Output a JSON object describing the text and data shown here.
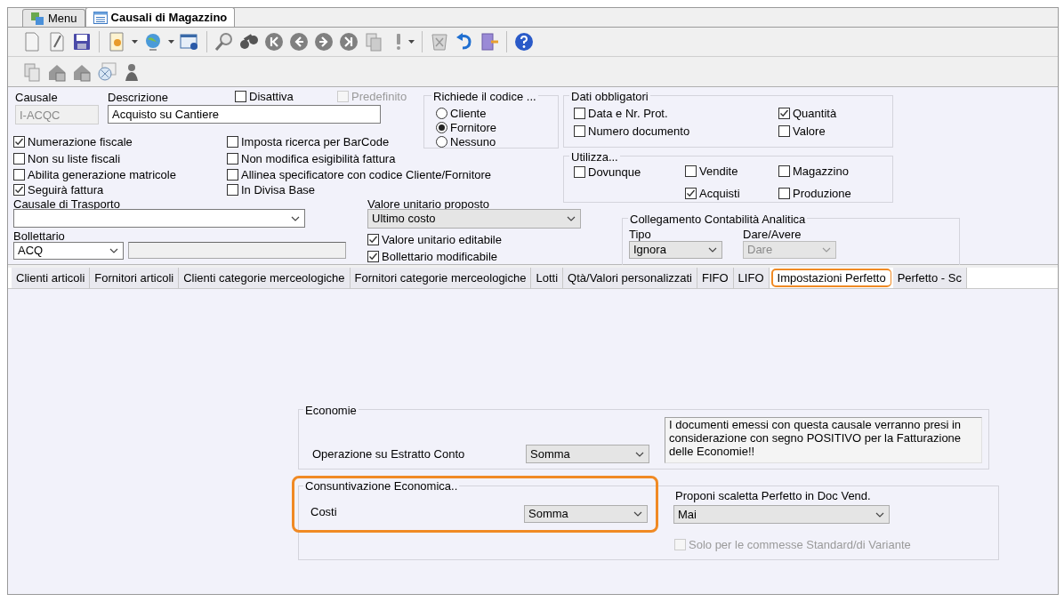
{
  "window_tabs": [
    {
      "label": "Menu",
      "selected": false
    },
    {
      "label": "Causali di Magazzino",
      "selected": true
    }
  ],
  "header": {
    "causale": {
      "label": "Causale",
      "value": "I-ACQC",
      "disabled": true
    },
    "descrizione": {
      "label": "Descrizione",
      "value": "Acquisto su Cantiere"
    },
    "flags": [
      {
        "label": "Disattiva",
        "checked": false,
        "disabled": false
      },
      {
        "label": "Predefinito",
        "checked": false,
        "disabled": true
      }
    ],
    "richiede": {
      "title": "Richiede il codice ...",
      "options": [
        {
          "label": "Cliente",
          "selected": false
        },
        {
          "label": "Fornitore",
          "selected": true
        },
        {
          "label": "Nessuno",
          "selected": false
        }
      ]
    },
    "dati_obbligatori": {
      "title": "Dati obbligatori",
      "items": [
        {
          "label": "Data e Nr. Prot.",
          "checked": false
        },
        {
          "label": "Quantità",
          "checked": true
        },
        {
          "label": "Numero documento",
          "checked": false
        },
        {
          "label": "Valore",
          "checked": false
        }
      ]
    },
    "utilizza": {
      "title": "Utilizza...",
      "items": [
        {
          "label": "Dovunque",
          "checked": false
        },
        {
          "label": "Vendite",
          "checked": false
        },
        {
          "label": "Magazzino",
          "checked": false
        },
        {
          "label": "Acquisti",
          "checked": true
        },
        {
          "label": "Produzione",
          "checked": false
        }
      ]
    },
    "options": [
      {
        "label": "Numerazione fiscale",
        "checked": true
      },
      {
        "label": "Non su liste fiscali",
        "checked": false
      },
      {
        "label": "Abilita generazione matricole",
        "checked": false
      },
      {
        "label": "Seguirà fattura",
        "checked": true
      },
      {
        "label": "Imposta ricerca per BarCode",
        "checked": false
      },
      {
        "label": "Non modifica esigibilità fattura",
        "checked": false
      },
      {
        "label": "Allinea specificatore con codice Cliente/Fornitore",
        "checked": false
      },
      {
        "label": "In Divisa Base",
        "checked": false
      }
    ],
    "causale_trasporto": {
      "label": "Causale di Trasporto"
    },
    "bollettario": {
      "label": "Bollettario",
      "value": "ACQ"
    },
    "valore_unitario": {
      "label": "Valore unitario proposto",
      "value": "Ultimo costo"
    },
    "valore_flags": [
      {
        "label": "Valore unitario editabile",
        "checked": true
      },
      {
        "label": "Bollettario modificabile",
        "checked": true
      }
    ],
    "collegamento": {
      "title": "Collegamento Contabilità Analitica",
      "tipo": {
        "label": "Tipo",
        "value": "Ignora"
      },
      "dare_avere": {
        "label": "Dare/Avere",
        "value": "Dare",
        "disabled": true
      }
    }
  },
  "page_tabs": [
    {
      "label": "Clienti articoli",
      "selected": false,
      "highlighted": false
    },
    {
      "label": "Fornitori articoli",
      "selected": false,
      "highlighted": false
    },
    {
      "label": "Clienti categorie merceologiche",
      "selected": false,
      "highlighted": false
    },
    {
      "label": "Fornitori categorie merceologiche",
      "selected": false,
      "highlighted": false
    },
    {
      "label": "Lotti",
      "selected": false,
      "highlighted": false
    },
    {
      "label": "Qtà/Valori personalizzati",
      "selected": false,
      "highlighted": false
    },
    {
      "label": "FIFO",
      "selected": false,
      "highlighted": false
    },
    {
      "label": "LIFO",
      "selected": false,
      "highlighted": false
    },
    {
      "label": "Impostazioni Perfetto",
      "selected": true,
      "highlighted": true
    },
    {
      "label": "Perfetto - Sc",
      "selected": false,
      "highlighted": false
    }
  ],
  "economie": {
    "title": "Economie",
    "operazione": {
      "label": "Operazione su Estratto Conto",
      "value": "Somma"
    },
    "note": "I documenti emessi con questa causale verranno presi in considerazione con segno POSITIVO per la Fatturazione delle Economie!!"
  },
  "consuntivazione": {
    "title": "Consuntivazione Economica..",
    "highlighted": true,
    "costi": {
      "label": "Costi",
      "value": "Somma"
    }
  },
  "proponi": {
    "label": "Proponi scaletta Perfetto in Doc Vend.",
    "value": "Mai",
    "solo": {
      "label": "Solo per le commesse Standard/di Variante",
      "checked": false,
      "disabled": true
    }
  }
}
